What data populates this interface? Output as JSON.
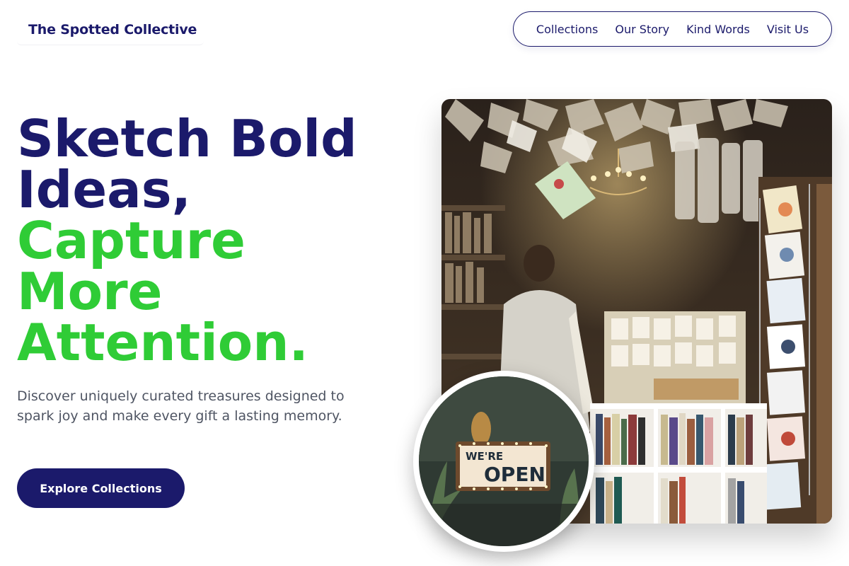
{
  "brand": {
    "name": "The Spotted Collective"
  },
  "nav": {
    "items": [
      {
        "label": "Collections"
      },
      {
        "label": "Our Story"
      },
      {
        "label": "Kind Words"
      },
      {
        "label": "Visit Us"
      }
    ]
  },
  "hero": {
    "title_line1": "Sketch Bold",
    "title_line2": "Ideas,",
    "title_line3": "Capture",
    "title_line4": "More",
    "title_line5": "Attention.",
    "subtitle": "Discover uniquely curated treasures designed to spark joy and make every gift a lasting memory.",
    "cta_label": "Explore Collections"
  },
  "images": {
    "main": {
      "description_icon": "shop-interior-photo"
    },
    "badge": {
      "sign_text_top": "WE'RE",
      "sign_text_bottom": "OPEN"
    }
  },
  "colors": {
    "navy": "#1b1a6b",
    "green": "#2fcc36",
    "text_gray": "#4f5563"
  }
}
